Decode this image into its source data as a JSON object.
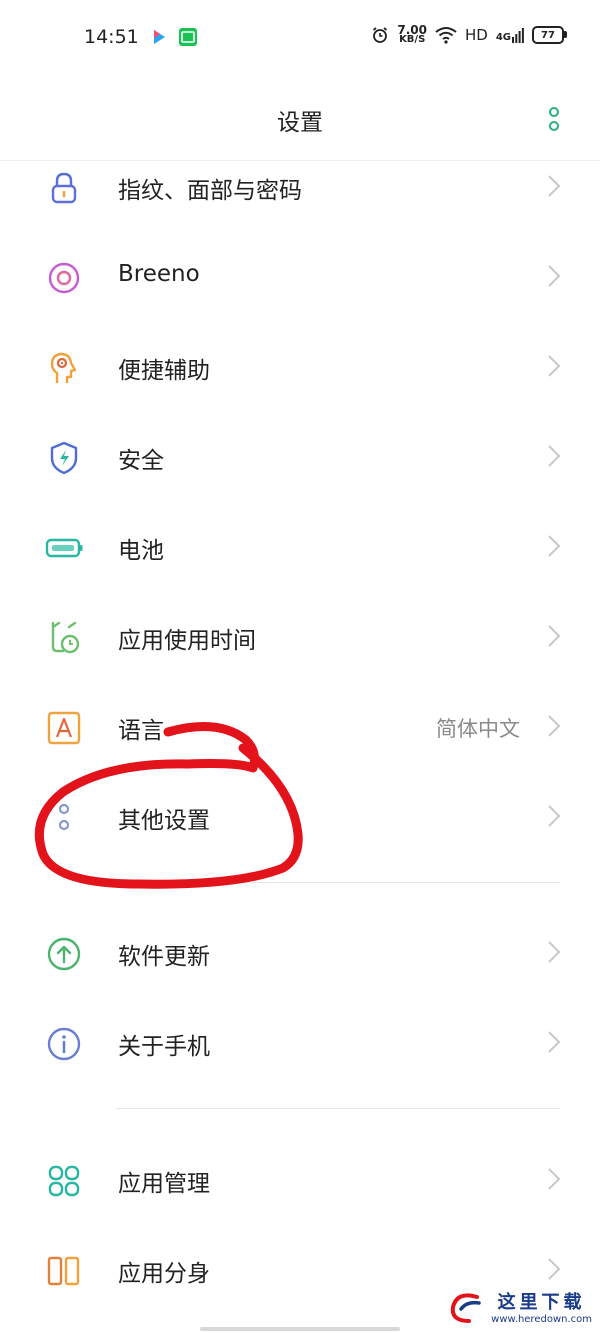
{
  "status_bar": {
    "time": "14:51",
    "net_speed": "7.00",
    "net_unit": "KB/S",
    "hd": "HD",
    "signal": "4G",
    "battery": "77"
  },
  "header": {
    "title": "设置"
  },
  "items": [
    {
      "label": "指纹、面部与密码",
      "icon": "lock-icon",
      "color": "#5b6fd8"
    },
    {
      "label": "Breeno",
      "icon": "breeno-icon",
      "color": "#c65bd8"
    },
    {
      "label": "便捷辅助",
      "icon": "head-assist-icon",
      "color": "#f0a23c"
    },
    {
      "label": "安全",
      "icon": "shield-icon",
      "color": "#4f6bd8"
    },
    {
      "label": "电池",
      "icon": "battery-icon",
      "color": "#27b7a3"
    },
    {
      "label": "应用使用时间",
      "icon": "app-time-icon",
      "color": "#6cbf6c"
    },
    {
      "label": "语言",
      "value": "简体中文",
      "icon": "language-icon",
      "color": "#f0a23c"
    },
    {
      "label": "其他设置",
      "icon": "dots-icon",
      "color": "#8a97c8"
    },
    {
      "label": "软件更新",
      "icon": "update-icon",
      "color": "#4cb36c"
    },
    {
      "label": "关于手机",
      "icon": "info-icon",
      "color": "#6a7fd0"
    },
    {
      "label": "应用管理",
      "icon": "app-grid-icon",
      "color": "#27b7a3"
    },
    {
      "label": "应用分身",
      "icon": "clone-icon",
      "color": "#e0813c"
    }
  ],
  "watermark": {
    "cn": "这里下载",
    "url": "www.heredown.com"
  },
  "colors": {
    "accent": "#27b07a",
    "annotation": "#e3131b"
  }
}
